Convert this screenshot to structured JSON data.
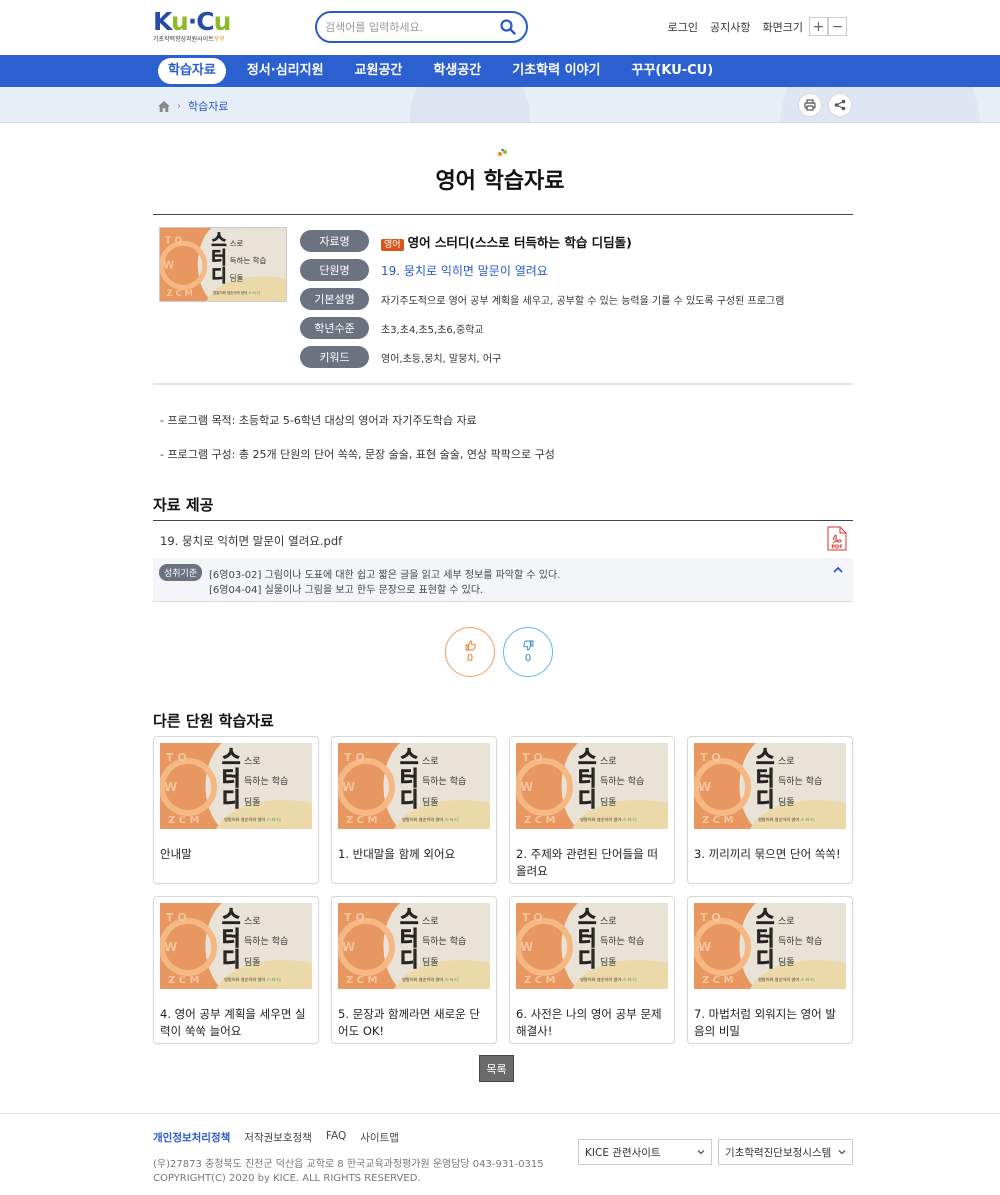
{
  "header": {
    "logo_text": "KU-CU",
    "logo_sub": "기초학력향상지원사이트",
    "logo_brand": "꾸꾸",
    "search_placeholder": "검색어를 입력하세요.",
    "login": "로그인",
    "notice": "공지사항",
    "zoom_label": "화면크기",
    "zoom_in": "+",
    "zoom_out": "−"
  },
  "nav": [
    {
      "label": "학습자료",
      "active": true
    },
    {
      "label": "정서·심리지원",
      "active": false
    },
    {
      "label": "교원공간",
      "active": false
    },
    {
      "label": "학생공간",
      "active": false
    },
    {
      "label": "기초학력 이야기",
      "active": false
    },
    {
      "label": "꾸꾸(KU-CU)",
      "active": false
    }
  ],
  "breadcrumb": {
    "current": "학습자료",
    "separator": "›"
  },
  "page_title": "영어 학습자료",
  "info": {
    "labels": {
      "name": "자료명",
      "unit": "단원명",
      "desc": "기본설명",
      "level": "학년수준",
      "keyword": "키워드"
    },
    "subject_tag": "영어",
    "name": "영어 스터디(스스로 터득하는 학습 디딤돌)",
    "unit": "19. 뭉치로 익히면 말문이 열려요",
    "desc": "자기주도적으로 영어 공부 계획을 세우고, 공부할 수 있는 능력을 기를 수 있도록 구성된 프로그램",
    "level": "초3,초4,초5,초6,중학교",
    "keyword": "영어,초등,뭉치, 말뭉치, 어구"
  },
  "thumbnail_text": {
    "line1": "스",
    "line1b": "스로",
    "line2": "터",
    "line2b": "득하는 학습",
    "line3": "디",
    "line3b": "딤돌",
    "tagline": "영말이와 영순이의 영어",
    "brand": "스·터·디"
  },
  "description": [
    "- 프로그램 목적: 초등학교 5-6학년 대상의 영어과 자기주도학습 자료",
    "- 프로그램 구성: 총 25개 단원의 단어 쏙쏙, 문장 술술, 표현 술술, 연상 팍팍으로 구성"
  ],
  "provide": {
    "heading": "자료 제공",
    "file_name": "19. 뭉치로 익히면 말문이 열려요.pdf",
    "file_type": "PDF",
    "standard_tag": "성취기준",
    "standards": [
      "[6영03-02] 그림이나 도표에 대한 쉽고 짧은 글을 읽고 세부 정보를 파악할 수 있다.",
      "[6영04-04] 실물이나 그림을 보고 한두 문장으로 표현할 수 있다."
    ]
  },
  "votes": {
    "like": "0",
    "dislike": "0"
  },
  "other": {
    "heading": "다른 단원 학습자료",
    "cards": [
      "안내말",
      "1. 반대말을 함께 외어요",
      "2. 주제와 관련된 단어들을 떠올려요",
      "3. 끼리끼리 묶으면 단어 쏙쏙!",
      "4. 영어 공부 계획을 세우면 실력이 쑥쑥 늘어요",
      "5. 문장과 함께라면 새로운 단어도 OK!",
      "6. 사전은 나의 영어 공부 문제 해결사!",
      "7. 마법처럼 외워지는 영어 발음의 비밀"
    ],
    "list_button": "목록"
  },
  "footer": {
    "links": [
      "개인정보처리정책",
      "저작권보호정책",
      "FAQ",
      "사이트맵"
    ],
    "address": "(우)27873 충청북도 진천군 덕산읍 교학로 8   한국교육과정평가원 운영담당 043-931-0315",
    "copyright": "COPYRIGHT(C) 2020 by KICE. ALL RIGHTS RESERVED.",
    "select1": "KICE 관련사이트",
    "select2": "기초학력진단보정시스템"
  },
  "colors": {
    "primary": "#2c5fd0",
    "subject": "#d9561b",
    "like": "#e8741e",
    "dislike": "#2a8ad0"
  }
}
